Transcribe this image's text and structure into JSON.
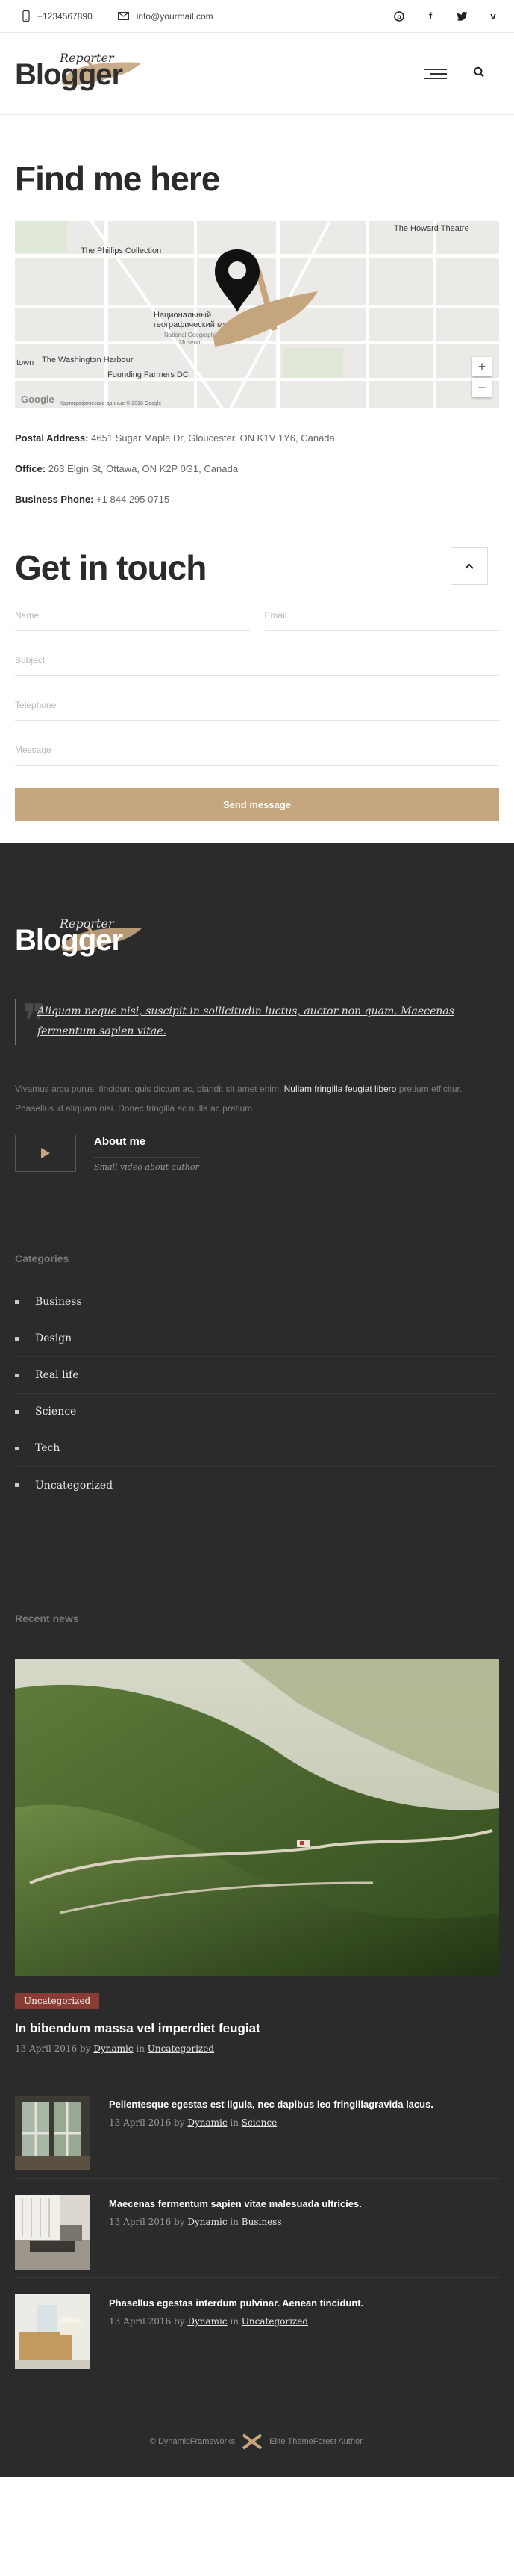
{
  "topbar": {
    "phone": "+1234567890",
    "email": "info@yourmail.com",
    "socials": [
      "pinterest-icon",
      "facebook-icon",
      "twitter-icon",
      "vimeo-icon"
    ]
  },
  "logo": {
    "word": "Blogger",
    "script": "Reporter",
    "accent_color": "#c4a57e"
  },
  "find": {
    "title": "Find me here",
    "map_labels": {
      "howard_theatre": "The Howard Theatre",
      "phillips": "The Phillips Collection",
      "museum_ru_1": "Национальный",
      "museum_ru_2": "географический музей",
      "museum_en_1": "National Geographic",
      "museum_en_2": "Museum",
      "harbour": "The Washington Harbour",
      "farmers": "Founding Farmers DC",
      "town": "town",
      "google": "Google",
      "attribution": "Картографические данные © 2018 Google"
    },
    "postal_label": "Postal Address:",
    "postal_value": "4651 Sugar Maple Dr, Gloucester, ON K1V 1Y6, Canada",
    "office_label": "Office:",
    "office_value": "263 Elgin St, Ottawa, ON K2P 0G1, Canada",
    "phone_label": "Business Phone:",
    "phone_value": "+1 844 295 0715"
  },
  "touch": {
    "title": "Get in touch",
    "name_placeholder": "Name",
    "email_placeholder": "Email",
    "subject_placeholder": "Subject",
    "telephone_placeholder": "Telephone",
    "message_placeholder": "Message",
    "send_label": "Send message"
  },
  "footer": {
    "quote": "Aliquam neque nisi, suscipit in sollicitudin luctus, auctor non quam. Maecenas fermentum sapien vitae.",
    "about_text_1": "Vivamus arcu purus, tincidunt quis dictum ac, blandit sit amet enim. ",
    "about_text_bold": "Nullam fringilla feugiat libero",
    "about_text_2": " pretium efficitur. Phasellus id aliquam nisi. Donec fringilla ac nulla ac pretium.",
    "about_title": "About me",
    "about_sub": "Small video about author",
    "categories_title": "Categories",
    "categories": [
      "Business",
      "Design",
      "Real life",
      "Science",
      "Tech",
      "Uncategorized"
    ],
    "news_title": "Recent news",
    "main_news": {
      "badge": "Uncategorized",
      "title": "In bibendum massa vel imperdiet feugiat",
      "date": "13 April 2016",
      "by": "by",
      "author": "Dynamic",
      "in": "in",
      "category": "Uncategorized"
    },
    "posts": [
      {
        "title": "Pellentesque egestas est ligula, nec dapibus leo fringillagravida lacus.",
        "date": "13 April 2016",
        "by": "by",
        "author": "Dynamic",
        "in": "in",
        "category": "Science"
      },
      {
        "title": "Maecenas fermentum sapien vitae malesuada ultricies.",
        "date": "13 April 2016",
        "by": "by",
        "author": "Dynamic",
        "in": "in",
        "category": "Business"
      },
      {
        "title": "Phasellus egestas interdum pulvinar. Aenean tincidunt.",
        "date": "13 April 2016",
        "by": "by",
        "author": "Dynamic",
        "in": "in",
        "category": "Uncategorized"
      }
    ],
    "copyright_left": "© DynamicFrameworks",
    "copyright_right": "Elite ThemeForest Author."
  }
}
